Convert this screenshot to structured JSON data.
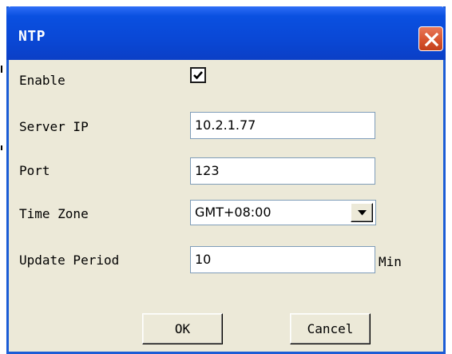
{
  "window": {
    "title": "NTP",
    "close_icon": "close-icon"
  },
  "form": {
    "enable": {
      "label": "Enable",
      "checked": true
    },
    "server_ip": {
      "label": "Server IP",
      "value": "10.2.1.77"
    },
    "port": {
      "label": "Port",
      "value": "123"
    },
    "time_zone": {
      "label": "Time Zone",
      "value": "GMT+08:00"
    },
    "update_period": {
      "label": "Update Period",
      "value": "10",
      "unit": "Min"
    }
  },
  "buttons": {
    "ok": "OK",
    "cancel": "Cancel"
  },
  "colors": {
    "titlebar": "#0a48d6",
    "dialog_bg": "#ece9d8",
    "close_button": "#d8542f",
    "field_border": "#7f9db9"
  }
}
